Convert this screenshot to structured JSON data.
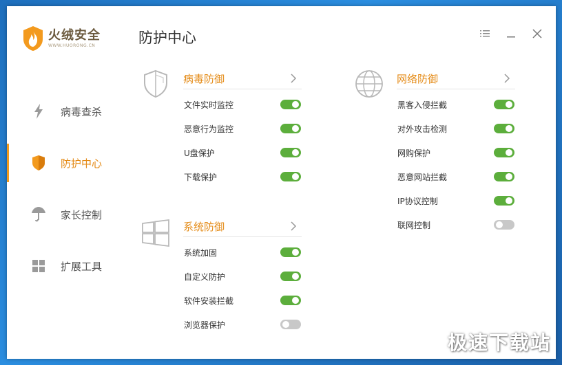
{
  "app": {
    "logo_title": "火绒安全",
    "logo_subtitle": "WWW.HUORONG.CN"
  },
  "colors": {
    "accent": "#e48a15",
    "toggle_on": "#5cae3c",
    "toggle_off": "#c8c8c8"
  },
  "sidebar": {
    "items": [
      {
        "label": "病毒查杀",
        "icon": "lightning-icon",
        "active": false
      },
      {
        "label": "防护中心",
        "icon": "shield-icon",
        "active": true
      },
      {
        "label": "家长控制",
        "icon": "umbrella-icon",
        "active": false
      },
      {
        "label": "扩展工具",
        "icon": "grid-icon",
        "active": false
      }
    ]
  },
  "header": {
    "title": "防护中心"
  },
  "sections": {
    "virus": {
      "title": "病毒防御",
      "icon": "shield-outline-icon",
      "items": [
        {
          "label": "文件实时监控",
          "enabled": true
        },
        {
          "label": "恶意行为监控",
          "enabled": true
        },
        {
          "label": "U盘保护",
          "enabled": true
        },
        {
          "label": "下载保护",
          "enabled": true
        }
      ]
    },
    "system": {
      "title": "系统防御",
      "icon": "windows-icon",
      "items": [
        {
          "label": "系统加固",
          "enabled": true
        },
        {
          "label": "自定义防护",
          "enabled": true
        },
        {
          "label": "软件安装拦截",
          "enabled": true
        },
        {
          "label": "浏览器保护",
          "enabled": false
        }
      ]
    },
    "network": {
      "title": "网络防御",
      "icon": "globe-icon",
      "items": [
        {
          "label": "黑客入侵拦截",
          "enabled": true
        },
        {
          "label": "对外攻击检测",
          "enabled": true
        },
        {
          "label": "网购保护",
          "enabled": true
        },
        {
          "label": "恶意网站拦截",
          "enabled": true
        },
        {
          "label": "IP协议控制",
          "enabled": true
        },
        {
          "label": "联网控制",
          "enabled": false
        }
      ]
    }
  },
  "watermark": "极速下载站"
}
